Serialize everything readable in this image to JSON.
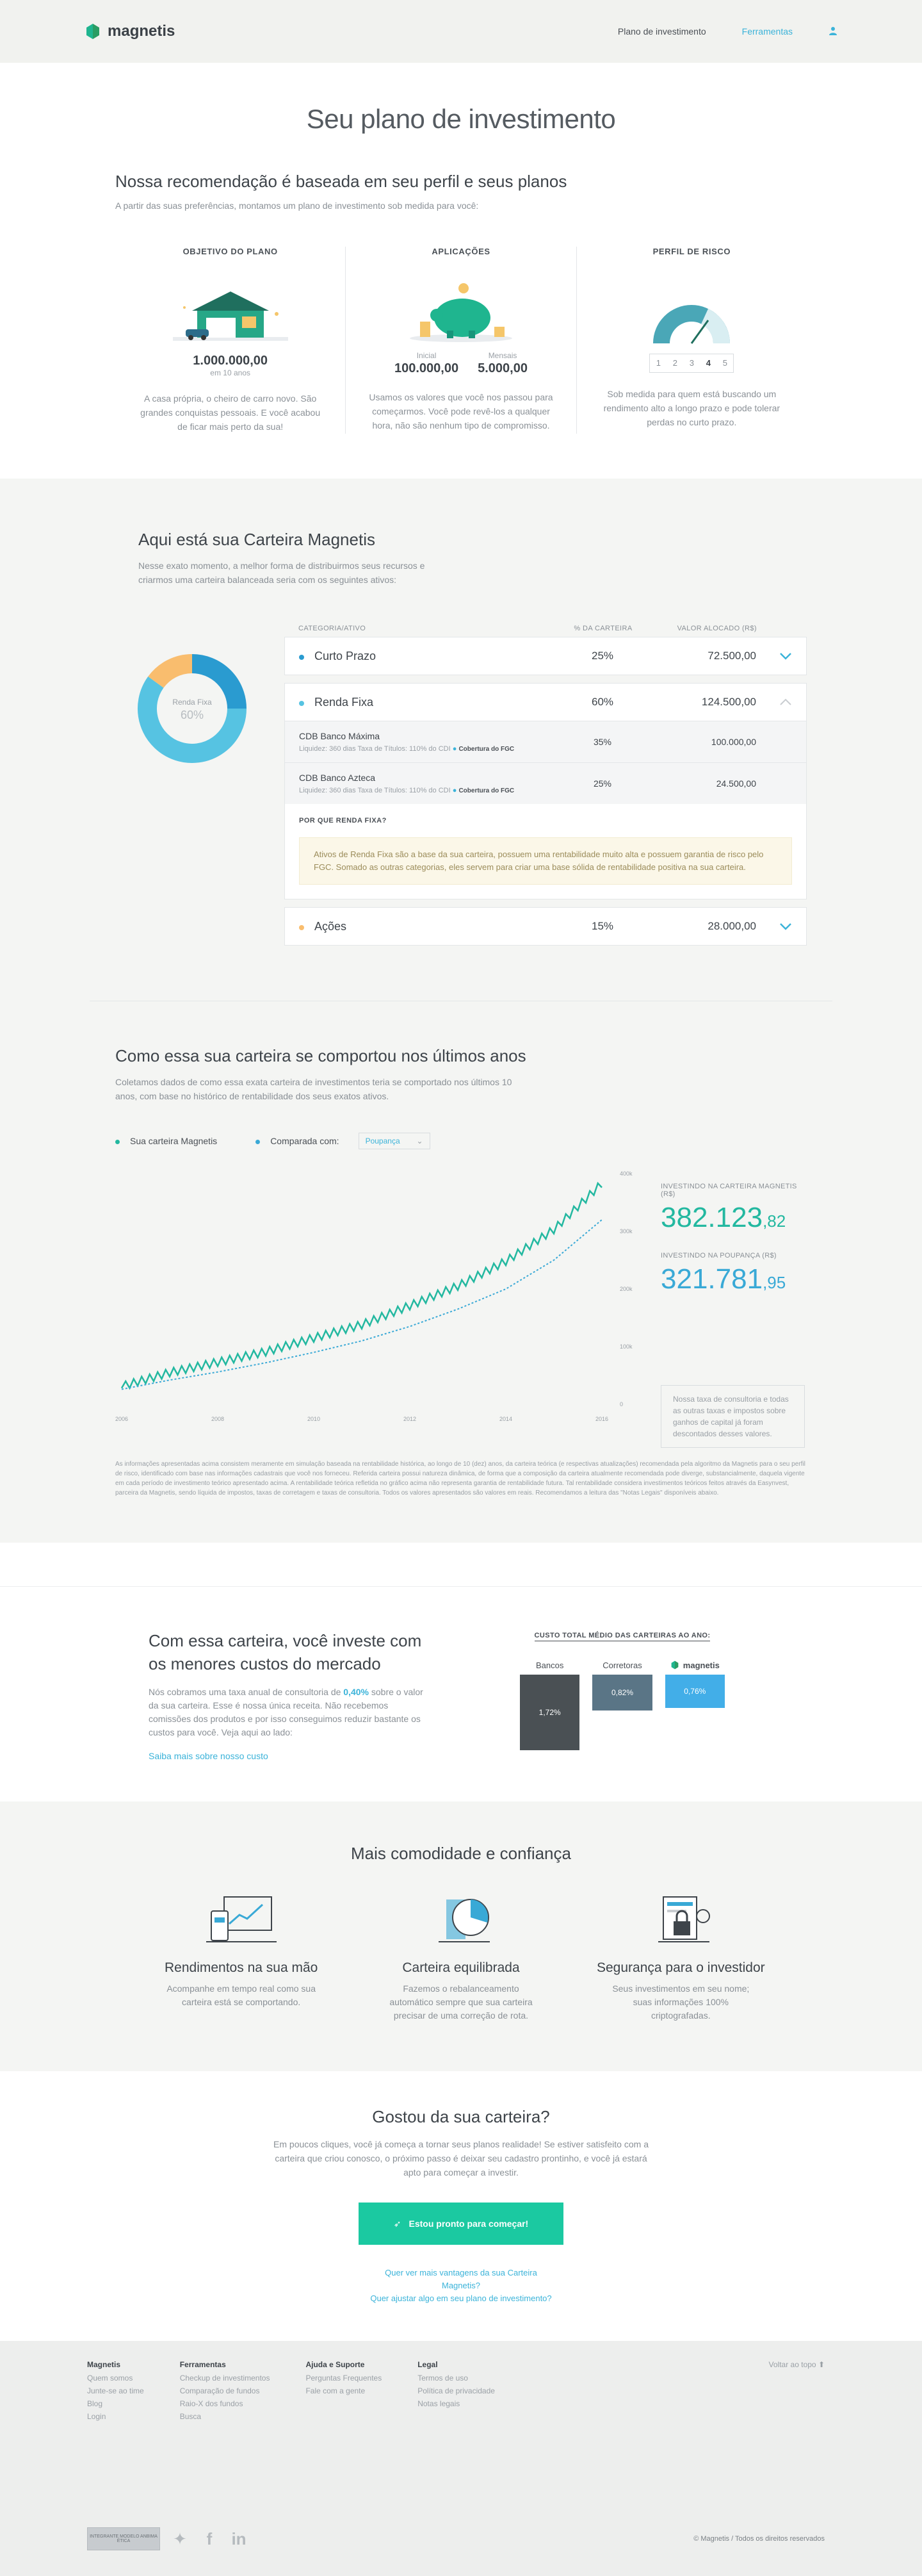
{
  "header": {
    "brand": "magnetis",
    "nav_plan": "Plano de investimento",
    "nav_tools": "Ferramentas",
    "user_icon": "user-icon"
  },
  "page": {
    "title": "Seu plano de investimento",
    "intro_title": "Nossa recomendação é baseada em seu perfil e seus planos",
    "intro_text": "A partir das suas preferências, montamos um plano de investimento sob medida para você:"
  },
  "objective": {
    "title": "OBJETIVO DO PLANO",
    "value": "1.000.000,00",
    "term": "em 10 anos",
    "desc": "A casa própria, o cheiro de carro novo. São grandes conquistas pessoais. E você acabou de ficar mais perto da sua!"
  },
  "applications": {
    "title": "APLICAÇÕES",
    "initial_label": "Inicial",
    "initial_value": "100.000,00",
    "monthly_label": "Mensais",
    "monthly_value": "5.000,00",
    "desc": "Usamos os valores que você nos passou para começarmos. Você pode revê-los a qualquer hora, não são nenhum tipo de compromisso."
  },
  "risk": {
    "title": "PERFIL DE RISCO",
    "levels": [
      "1",
      "2",
      "3",
      "4",
      "5"
    ],
    "selected": "4",
    "desc": "Sob medida para quem está buscando um rendimento alto a longo prazo e pode tolerar perdas no curto prazo."
  },
  "portfolio": {
    "title": "Aqui está sua Carteira Magnetis",
    "subtitle": "Nesse exato momento, a melhor forma de distribuirmos seus recursos e criarmos uma carteira balanceada seria com os seguintes ativos:",
    "donut_label": "Renda Fixa",
    "donut_value": "60%",
    "col_category": "CATEGORIA/ATIVO",
    "col_pct": "% DA CARTEIRA",
    "col_value": "VALOR ALOCADO (R$)",
    "rows": [
      {
        "name": "Curto Prazo",
        "pct": "25%",
        "value": "72.500,00",
        "color": "#2a9bd0",
        "share": 25
      },
      {
        "name": "Renda Fixa",
        "pct": "60%",
        "value": "124.500,00",
        "color": "#56c3e2",
        "share": 60
      },
      {
        "name": "Ações",
        "pct": "15%",
        "value": "28.000,00",
        "color": "#f9bd6e",
        "share": 15
      }
    ],
    "assets": [
      {
        "name": "CDB Banco Máxima",
        "meta": "Liquidez: 360 dias    Taxa de Títulos: 110% do CDI",
        "fgc": "Cobertura do FGC",
        "pct": "35%",
        "value": "100.000,00"
      },
      {
        "name": "CDB Banco Azteca",
        "meta": "Liquidez: 360 dias    Taxa de Títulos: 110% do CDI",
        "fgc": "Cobertura do FGC",
        "pct": "25%",
        "value": "24.500,00"
      }
    ],
    "why_title": "POR QUE RENDA FIXA?",
    "why_text": "Ativos de Renda Fixa são a base da sua carteira, possuem uma rentabilidade muito alta e possuem garantia de risco pelo FGC. Somado as outras categorias, eles servem para criar uma base sólida de rentabilidade positiva na sua carteira."
  },
  "performance": {
    "title": "Como essa sua carteira se comportou nos últimos anos",
    "subtitle": "Coletamos dados de como essa exata carteira de investimentos teria se comportado nos últimos 10 anos, com base no histórico de rentabilidade dos seus exatos ativos.",
    "legend_magnetis": "Sua carteira Magnetis",
    "legend_compare": "Comparada com:",
    "compare_select": "Poupança",
    "label_magnetis": "INVESTINDO NA CARTEIRA MAGNETIS (R$)",
    "value_magnetis_int": "382.123",
    "value_magnetis_dec": ",82",
    "label_poupanca": "INVESTINDO NA POUPANÇA (R$)",
    "value_poupanca_int": "321.781",
    "value_poupanca_dec": ",95",
    "note": "Nossa taxa de consultoria e todas as outras taxas e impostos sobre ganhos de capital já foram descontados desses valores.",
    "disclaimer": "As informações apresentadas acima consistem meramente em simulação baseada na rentabilidade histórica, ao longo de 10 (dez) anos, da carteira teórica (e respectivas atualizações) recomendada pela algoritmo da Magnetis para o seu perfil de risco, identificado com base nas informações cadastrais que você nos forneceu. Referida carteira possui natureza dinâmica, de forma que a composição da carteira atualmente recomendada pode diverge, substancialmente, daquela vigente em cada período de investimento teórico apresentado acima. A rentabilidade teórica refletida no gráfico acima não representa garantia de rentabilidade futura. Tal rentabilidade considera investimentos teóricos feitos através da Easynvest, parceira da Magnetis, sendo líquida de impostos, taxas de corretagem e taxas de consultoria. Todos os valores apresentados são valores em reais. Recomendamos a leitura das \"Notas Legais\" disponíveis abaixo."
  },
  "chart_data": {
    "type": "line",
    "x": [
      "2006",
      "2007",
      "2008",
      "2009",
      "2010",
      "2011",
      "2012",
      "2013",
      "2014",
      "2015",
      "2016"
    ],
    "series": [
      {
        "name": "Sua carteira Magnetis",
        "values": [
          28,
          52,
          70,
          88,
          112,
          135,
          168,
          202,
          245,
          300,
          380
        ]
      },
      {
        "name": "Poupança",
        "values": [
          26,
          42,
          56,
          72,
          90,
          110,
          135,
          165,
          200,
          250,
          320
        ]
      }
    ],
    "xticks": [
      "2006",
      "2008",
      "2010",
      "2012",
      "2014",
      "2016"
    ],
    "yticks": [
      "0",
      "100k",
      "200k",
      "300k",
      "400k"
    ],
    "ylim": [
      0,
      400
    ],
    "colors": [
      "#23b8a0",
      "#39a9d6"
    ]
  },
  "cost": {
    "title": "Com essa carteira, você investe com os menores custos do mercado",
    "text_before": "Nós cobramos uma taxa anual de consultoria de ",
    "text_rate": "0,40%",
    "text_after": " sobre o valor da sua carteira. Esse é nossa única receita. Não recebemos comissões dos produtos e por isso conseguimos reduzir bastante os custos para você. Veja aqui ao lado:",
    "link": "Saiba mais sobre nosso custo",
    "chart_title": "CUSTO TOTAL MÉDIO DAS CARTEIRAS AO ANO:",
    "bars": [
      {
        "label": "Bancos",
        "value": "1,72%",
        "v": 1.72,
        "color": "#4a5054"
      },
      {
        "label": "Corretoras",
        "value": "0,82%",
        "v": 0.82,
        "color": "#5a7586"
      },
      {
        "label": "magnetis",
        "value": "0,76%",
        "v": 0.76,
        "color": "#42aee8"
      }
    ]
  },
  "features": {
    "title": "Mais comodidade e confiança",
    "items": [
      {
        "title": "Rendimentos na sua mão",
        "text": "Acompanhe em tempo real como sua carteira está se comportando."
      },
      {
        "title": "Carteira equilibrada",
        "text": "Fazemos o rebalanceamento automático sempre que sua carteira precisar de uma correção de rota."
      },
      {
        "title": "Segurança para o investidor",
        "text": "Seus investimentos em seu nome; suas informações 100% criptografadas."
      }
    ]
  },
  "cta": {
    "title": "Gostou da sua carteira?",
    "text": "Em poucos cliques, você já começa a tornar seus planos realidade! Se estiver satisfeito com a carteira que criou conosco, o próximo passo é deixar seu cadastro prontinho, e você já estará apto para começar a investir.",
    "button": "Estou pronto para começar!",
    "link1": "Quer ver mais vantagens da sua Carteira Magnetis?",
    "link2": "Quer ajustar algo em seu plano de investimento?"
  },
  "footer": {
    "cols": [
      {
        "title": "Magnetis",
        "items": [
          "Quem somos",
          "Junte-se ao time",
          "Blog",
          "Login"
        ]
      },
      {
        "title": "Ferramentas",
        "items": [
          "Checkup de investimentos",
          "Comparação de fundos",
          "Raio-X dos fundos",
          "Busca"
        ]
      },
      {
        "title": "Ajuda e Suporte",
        "items": [
          "Perguntas Frequentes",
          "Fale com a gente"
        ]
      },
      {
        "title": "Legal",
        "items": [
          "Termos de uso",
          "Política de privacidade",
          "Notas legais"
        ]
      }
    ],
    "back_top": "Voltar ao topo",
    "badge": "INTEGRANTE MODELO ANBIMA ÉTICA",
    "copyright": "© Magnetis / Todos os direitos reservados"
  }
}
